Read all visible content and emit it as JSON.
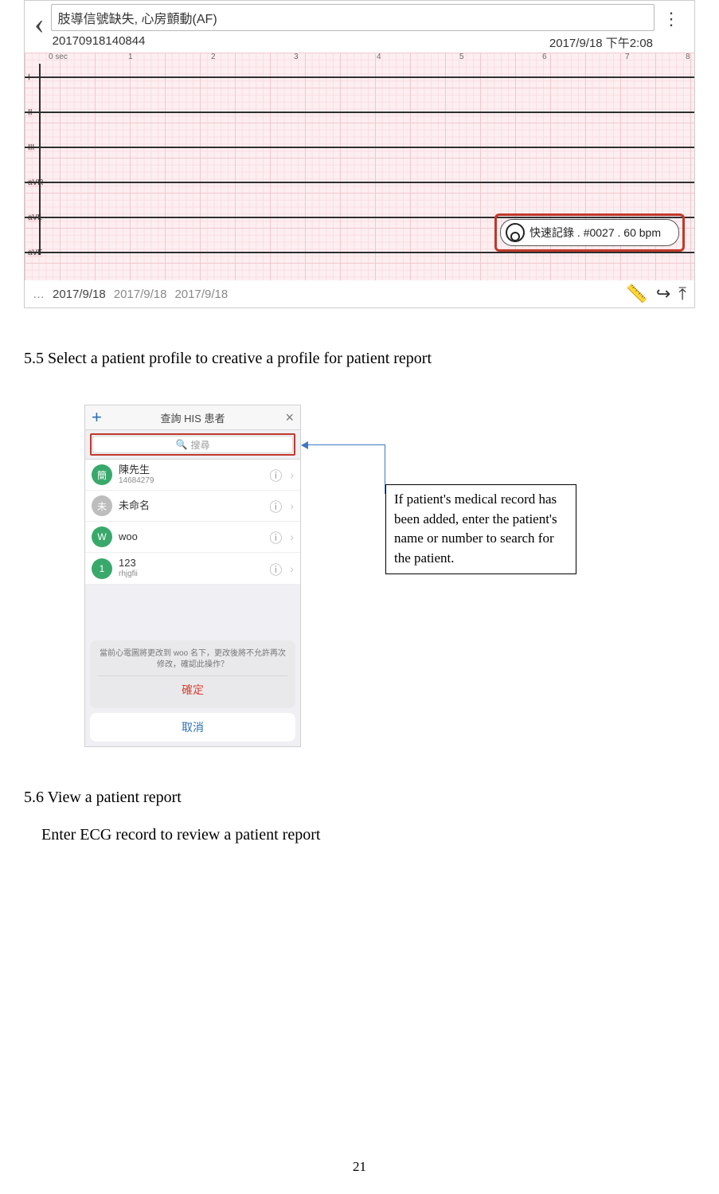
{
  "ecg": {
    "title": "肢導信號缺失, 心房顫動(AF)",
    "record_id": "20170918140844",
    "datetime": "2017/9/18 下午2:08",
    "sec_label": "0 sec",
    "sec_marks": [
      "1",
      "2",
      "3",
      "4",
      "5",
      "6",
      "7",
      "8"
    ],
    "leads": [
      "I",
      "II",
      "III",
      "aVR",
      "aVL",
      "aVF"
    ],
    "callout": "快速記錄 . #0027 . 60 bpm",
    "footer_ellipsis": "…",
    "dates": [
      "2017/9/18",
      "2017/9/18",
      "2017/9/18"
    ]
  },
  "section55_num": "5.5",
  "section55_txt": " Select a patient profile to creative a profile for patient report",
  "shot2": {
    "bar_title": "查詢 HIS 患者",
    "search_placeholder": "搜尋",
    "items": [
      {
        "avatar": "簡",
        "ava_color": "#39a96b",
        "name": "陳先生",
        "sub": "14684279"
      },
      {
        "avatar": "未",
        "ava_color": "#bdbdbd",
        "name": "未命名",
        "sub": ""
      },
      {
        "avatar": "W",
        "ava_color": "#39a96b",
        "name": "woo",
        "sub": ""
      },
      {
        "avatar": "1",
        "ava_color": "#39a96b",
        "name": "123",
        "sub": "rhjgfii"
      }
    ],
    "sheet_msg": "當前心電圖將更改到 woo 名下，更改後將不允許再次修改，確認此操作？",
    "confirm": "確定",
    "cancel": "取消"
  },
  "annotation": "If patient's medical record has been added, enter the patient's name or number to search for the patient.",
  "section56_num": "5.6",
  "section56_txt": " View a patient report",
  "section56_body": "Enter ECG record to review a patient report",
  "page_num": "21"
}
